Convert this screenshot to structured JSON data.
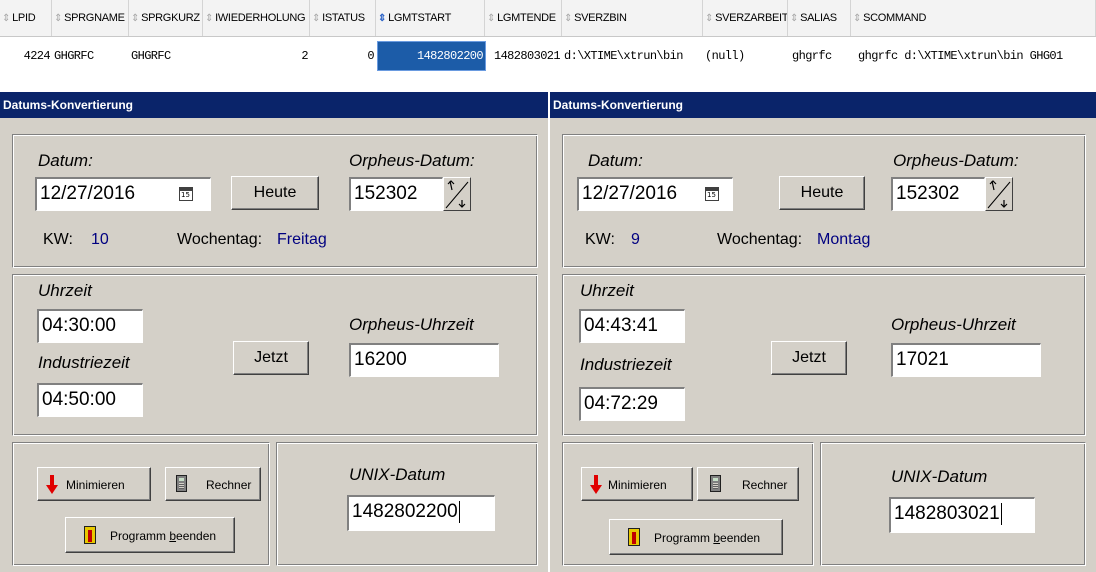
{
  "grid": {
    "columns": [
      "LPID",
      "SPRGNAME",
      "SPRGKURZ",
      "IWIEDERHOLUNG",
      "ISTATUS",
      "LGMTSTART",
      "LGMTENDE",
      "SVERZBIN",
      "SVERZARBEIT",
      "SALIAS",
      "SCOMMAND"
    ],
    "sorted_column": "LGMTSTART",
    "row": {
      "LPID": "4224",
      "SPRGNAME": "GHGRFC",
      "SPRGKURZ": "GHGRFC",
      "IWIEDERHOLUNG": "2",
      "ISTATUS": "0",
      "LGMTSTART": "1482802200",
      "LGMTENDE": "1482803021",
      "SVERZBIN": "d:\\XTIME\\xtrun\\bin",
      "SVERZARBEIT": "(null)",
      "SALIAS": "ghgrfc",
      "SCOMMAND": "ghgrfc d:\\XTIME\\xtrun\\bin GHG01"
    }
  },
  "dialogs": [
    {
      "title": "Datums-Konvertierung",
      "datum_label": "Datum:",
      "datum_value": "12/27/2016",
      "calendar_icon_text": "15",
      "heute_label": "Heute",
      "orpheus_datum_label": "Orpheus-Datum:",
      "orpheus_datum_value": "152302",
      "kw_label": "KW:",
      "kw_value": "10",
      "wochentag_label": "Wochentag:",
      "wochentag_value": "Freitag",
      "uhrzeit_label": "Uhrzeit",
      "uhrzeit_value": "04:30:00",
      "industriezeit_label": "Industriezeit",
      "industriezeit_value": "04:50:00",
      "jetzt_label": "Jetzt",
      "orpheus_uhrzeit_label": "Orpheus-Uhrzeit",
      "orpheus_uhrzeit_value": "16200",
      "minimieren_label": "Minimieren",
      "rechner_label": "Rechner",
      "beenden_prefix": "Programm ",
      "beenden_underlined": "b",
      "beenden_suffix": "eenden",
      "unix_label": "UNIX-Datum",
      "unix_value": "1482802200"
    },
    {
      "title": "Datums-Konvertierung",
      "datum_label": "Datum:",
      "datum_value": "12/27/2016",
      "calendar_icon_text": "15",
      "heute_label": "Heute",
      "orpheus_datum_label": "Orpheus-Datum:",
      "orpheus_datum_value": "152302",
      "kw_label": "KW:",
      "kw_value": "9",
      "wochentag_label": "Wochentag:",
      "wochentag_value": "Montag",
      "uhrzeit_label": "Uhrzeit",
      "uhrzeit_value": "04:43:41",
      "industriezeit_label": "Industriezeit",
      "industriezeit_value": "04:72:29",
      "jetzt_label": "Jetzt",
      "orpheus_uhrzeit_label": "Orpheus-Uhrzeit",
      "orpheus_uhrzeit_value": "17021",
      "minimieren_label": "Minimieren",
      "rechner_label": "Rechner",
      "beenden_prefix": "Programm ",
      "beenden_underlined": "b",
      "beenden_suffix": "eenden",
      "unix_label": "UNIX-Datum",
      "unix_value": "1482803021"
    }
  ],
  "colors": {
    "titlebar": "#0a246a",
    "dialog_face": "#d4d0c8",
    "selected_cell": "#1c5ca8",
    "value_blue": "#000080"
  }
}
